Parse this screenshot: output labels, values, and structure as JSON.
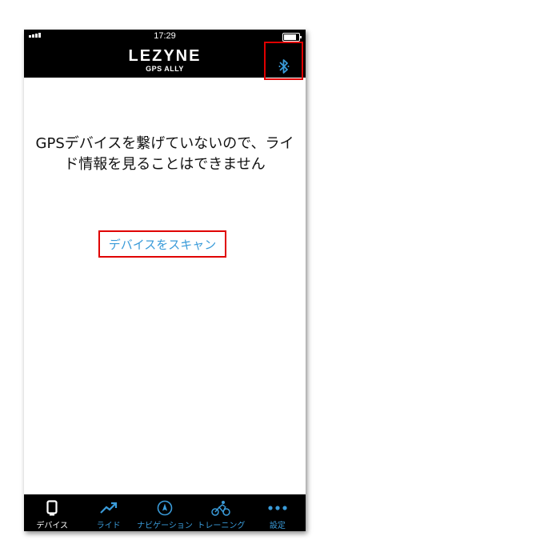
{
  "status_bar": {
    "time": "17:29"
  },
  "header": {
    "logo": "LEZYNE",
    "subtitle": "GPS ALLY",
    "bluetooth_icon": "bluetooth-icon"
  },
  "main": {
    "message_line1": "GPSデバイスを繋げていないので、ライ",
    "message_line2": "ド情報を見ることはできません",
    "scan_button": "デバイスをスキャン"
  },
  "tabs": [
    {
      "label": "デバイス",
      "icon": "device-icon",
      "active": true
    },
    {
      "label": "ライド",
      "icon": "ride-trend-icon",
      "active": false
    },
    {
      "label": "ナビゲーション",
      "icon": "compass-icon",
      "active": false
    },
    {
      "label": "トレーニング",
      "icon": "cyclist-icon",
      "active": false
    },
    {
      "label": "設定",
      "icon": "more-dots-icon",
      "active": false
    }
  ],
  "colors": {
    "accent": "#3a9bd9",
    "highlight": "#e00000",
    "bar": "#000000"
  }
}
